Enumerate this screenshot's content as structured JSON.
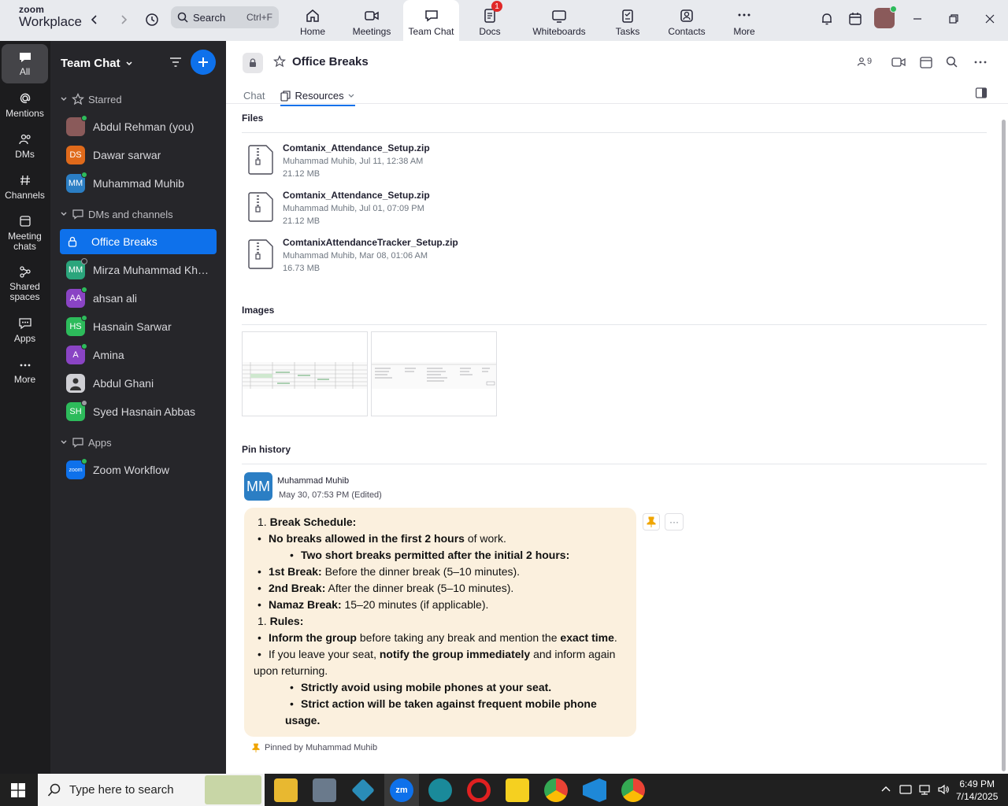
{
  "app": {
    "brand_top": "zoom",
    "brand_bottom": "Workplace"
  },
  "search": {
    "label": "Search",
    "shortcut": "Ctrl+F"
  },
  "nav_tabs": [
    {
      "label": "Home",
      "icon": "home-icon"
    },
    {
      "label": "Meetings",
      "icon": "video-icon"
    },
    {
      "label": "Team Chat",
      "icon": "chat-icon",
      "active": true
    },
    {
      "label": "Docs",
      "icon": "docs-icon",
      "badge": "1"
    },
    {
      "label": "Whiteboards",
      "icon": "whiteboard-icon"
    },
    {
      "label": "Tasks",
      "icon": "tasks-icon"
    },
    {
      "label": "Contacts",
      "icon": "contacts-icon"
    },
    {
      "label": "More",
      "icon": "more-icon"
    }
  ],
  "rail": [
    {
      "label": "All",
      "icon": "chat-bubble-icon"
    },
    {
      "label": "Mentions",
      "icon": "at-icon"
    },
    {
      "label": "DMs",
      "icon": "people-icon"
    },
    {
      "label": "Channels",
      "icon": "hash-icon"
    },
    {
      "label": "Meeting chats",
      "icon": "calendar-icon"
    },
    {
      "label": "Shared spaces",
      "icon": "share-icon"
    },
    {
      "label": "Apps",
      "icon": "apps-icon"
    },
    {
      "label": "More",
      "icon": "more-icon"
    }
  ],
  "sidebar": {
    "title": "Team Chat",
    "starred_label": "Starred",
    "dms_label": "DMs and channels",
    "apps_label": "Apps",
    "starred": [
      {
        "name": "Abdul Rehman (you)",
        "initials": "",
        "color": "#8a5a5a",
        "status": "#2dbb5b"
      },
      {
        "name": "Dawar sarwar",
        "initials": "DS",
        "color": "#e06a1b",
        "status": ""
      },
      {
        "name": "Muhammad Muhib",
        "initials": "MM",
        "color": "#2b7ec4",
        "status": "#2dbb5b"
      }
    ],
    "channels": [
      {
        "name": "Office Breaks",
        "selected": true
      },
      {
        "name": "Mirza Muhammad Khur...",
        "initials": "MM",
        "color": "#2ba57c",
        "status": "#9a9aa0"
      },
      {
        "name": "ahsan ali",
        "initials": "AA",
        "color": "#8a44c4",
        "status": "#2dbb5b"
      },
      {
        "name": "Hasnain Sarwar",
        "initials": "HS",
        "color": "#2dbb5b",
        "status": "#2dbb5b"
      },
      {
        "name": "Amina",
        "initials": "A",
        "color": "#8a44c4",
        "status": "#2dbb5b"
      },
      {
        "name": "Abdul Ghani",
        "initials": "",
        "color": "#cfcfd4",
        "status": ""
      },
      {
        "name": "Syed Hasnain Abbas",
        "initials": "SH",
        "color": "#2dbb5b",
        "status": "#9a9aa0"
      }
    ],
    "apps": [
      {
        "name": "Zoom Workflow",
        "initials": "zoom",
        "color": "#0e71eb",
        "status": "#2dbb5b"
      }
    ]
  },
  "channel": {
    "title": "Office Breaks",
    "members": "9",
    "tab_chat": "Chat",
    "tab_resources": "Resources"
  },
  "files_title": "Files",
  "files": [
    {
      "name": "Comtanix_Attendance_Setup.zip",
      "meta": "Muhammad Muhib, Jul 11, 12:38 AM",
      "size": "21.12 MB"
    },
    {
      "name": "Comtanix_Attendance_Setup.zip",
      "meta": "Muhammad Muhib, Jul 01, 07:09 PM",
      "size": "21.12 MB"
    },
    {
      "name": "ComtanixAttendanceTracker_Setup.zip",
      "meta": "Muhammad Muhib, Mar 08, 01:06 AM",
      "size": "16.73 MB"
    }
  ],
  "images_title": "Images",
  "pin_title": "Pin history",
  "pin": {
    "author": "Muhammad Muhib",
    "initials": "MM",
    "date": "May 30, 07:53 PM (Edited)",
    "pinned_by": "Pinned by Muhammad Muhib",
    "l1": "Break Schedule:",
    "l2b": "No breaks allowed in the first 2 hours",
    "l2": " of work.",
    "l3": "Two short breaks permitted after the initial 2 hours:",
    "l4b": "1st Break:",
    "l4": " Before the dinner break (5–10 minutes).",
    "l5b": "2nd Break:",
    "l5": " After the dinner break (5–10 minutes).",
    "l6b": "Namaz Break:",
    "l6": " 15–20 minutes (if applicable).",
    "l7": "Rules:",
    "l8b": "Inform the group",
    "l8": " before taking any break and mention the ",
    "l8c": "exact time",
    "l9": "If you leave your seat, ",
    "l9b": "notify the group immediately",
    "l9c": " and inform again",
    "l10": "upon returning.",
    "l11": "Strictly avoid using mobile phones at your seat.",
    "l12": "Strict action will be taken against frequent mobile phone",
    "l13": "usage."
  },
  "taskbar": {
    "search_placeholder": "Type here to search",
    "time": "6:49 PM",
    "date": "7/14/2025"
  }
}
